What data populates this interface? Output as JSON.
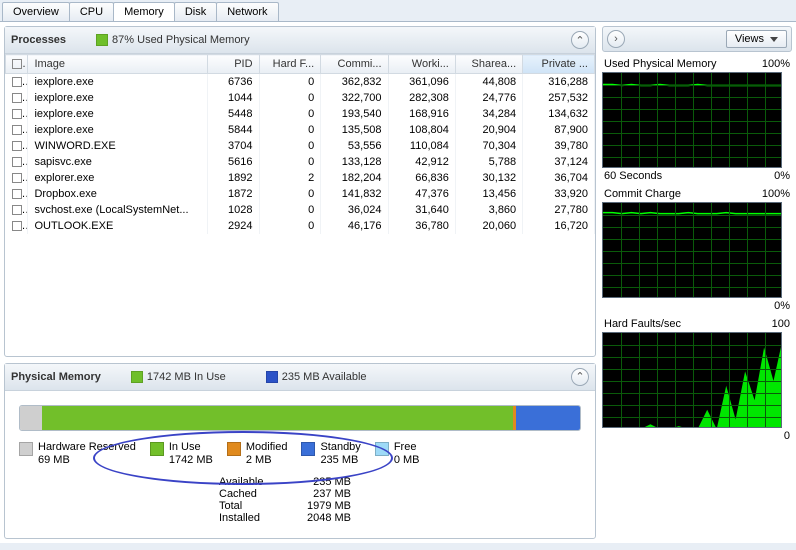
{
  "tabs": [
    "Overview",
    "CPU",
    "Memory",
    "Disk",
    "Network"
  ],
  "active_tab": 2,
  "processes": {
    "title": "Processes",
    "usage_pct": "87% Used Physical Memory",
    "usage_color": "#6fbf2a",
    "columns": [
      "Image",
      "PID",
      "Hard F...",
      "Commi...",
      "Worki...",
      "Sharea...",
      "Private ..."
    ],
    "sorted_col": 6,
    "rows": [
      {
        "image": "iexplore.exe",
        "pid": 6736,
        "hard": 0,
        "commit": "362,832",
        "working": "361,096",
        "share": "44,808",
        "private": "316,288"
      },
      {
        "image": "iexplore.exe",
        "pid": 1044,
        "hard": 0,
        "commit": "322,700",
        "working": "282,308",
        "share": "24,776",
        "private": "257,532"
      },
      {
        "image": "iexplore.exe",
        "pid": 5448,
        "hard": 0,
        "commit": "193,540",
        "working": "168,916",
        "share": "34,284",
        "private": "134,632"
      },
      {
        "image": "iexplore.exe",
        "pid": 5844,
        "hard": 0,
        "commit": "135,508",
        "working": "108,804",
        "share": "20,904",
        "private": "87,900"
      },
      {
        "image": "WINWORD.EXE",
        "pid": 3704,
        "hard": 0,
        "commit": "53,556",
        "working": "110,084",
        "share": "70,304",
        "private": "39,780"
      },
      {
        "image": "sapisvc.exe",
        "pid": 5616,
        "hard": 0,
        "commit": "133,128",
        "working": "42,912",
        "share": "5,788",
        "private": "37,124"
      },
      {
        "image": "explorer.exe",
        "pid": 1892,
        "hard": 2,
        "commit": "182,204",
        "working": "66,836",
        "share": "30,132",
        "private": "36,704"
      },
      {
        "image": "Dropbox.exe",
        "pid": 1872,
        "hard": 0,
        "commit": "141,832",
        "working": "47,376",
        "share": "13,456",
        "private": "33,920"
      },
      {
        "image": "svchost.exe (LocalSystemNet...",
        "pid": 1028,
        "hard": 0,
        "commit": "36,024",
        "working": "31,640",
        "share": "3,860",
        "private": "27,780"
      },
      {
        "image": "OUTLOOK.EXE",
        "pid": 2924,
        "hard": 0,
        "commit": "46,176",
        "working": "36,780",
        "share": "20,060",
        "private": "16,720"
      }
    ]
  },
  "phys": {
    "title": "Physical Memory",
    "in_use_mb": "1742 MB In Use",
    "in_use_color": "#6fbf2a",
    "available_mb": "235 MB Available",
    "available_color": "#2b52c7",
    "segments": [
      {
        "label": "Hardware Reserved",
        "value": "69 MB",
        "color": "#cfcfcf",
        "width": "4%"
      },
      {
        "label": "In Use",
        "value": "1742 MB",
        "color": "#72bf2a",
        "width": "84%"
      },
      {
        "label": "Modified",
        "value": "2 MB",
        "color": "#e08a1e",
        "width": "0.5%"
      },
      {
        "label": "Standby",
        "value": "235 MB",
        "color": "#3a6fd8",
        "width": "11.5%"
      },
      {
        "label": "Free",
        "value": "0 MB",
        "color": "#9edaf7",
        "width": "0%"
      }
    ],
    "summary": [
      {
        "lbl": "Available",
        "val": "235 MB"
      },
      {
        "lbl": "Cached",
        "val": "237 MB"
      },
      {
        "lbl": "Total",
        "val": "1979 MB"
      },
      {
        "lbl": "Installed",
        "val": "2048 MB"
      }
    ]
  },
  "right": {
    "views_label": "Views",
    "graphs": [
      {
        "title": "Used Physical Memory",
        "max": "100%",
        "bottom_left": "60 Seconds",
        "bottom_right": "0%",
        "type": "flat-high"
      },
      {
        "title": "Commit Charge",
        "max": "100%",
        "bottom_left": "",
        "bottom_right": "0%",
        "type": "flat-high"
      },
      {
        "title": "Hard Faults/sec",
        "max": "100",
        "bottom_left": "",
        "bottom_right": "0",
        "type": "spiky"
      }
    ]
  },
  "chart_data": [
    {
      "type": "line",
      "title": "Used Physical Memory",
      "ylabel": "%",
      "ylim": [
        0,
        100
      ],
      "x_span_seconds": 60,
      "values": [
        88,
        88,
        87,
        88,
        87,
        87,
        88,
        87,
        87,
        87,
        88,
        87,
        87,
        87,
        87,
        87,
        87,
        87,
        87,
        87
      ]
    },
    {
      "type": "line",
      "title": "Commit Charge",
      "ylabel": "%",
      "ylim": [
        0,
        100
      ],
      "x_span_seconds": 60,
      "values": [
        90,
        90,
        89,
        90,
        89,
        90,
        89,
        89,
        89,
        90,
        89,
        89,
        89,
        90,
        89,
        89,
        89,
        89,
        89,
        89
      ]
    },
    {
      "type": "area",
      "title": "Hard Faults/sec",
      "ylabel": "faults/s",
      "ylim": [
        0,
        100
      ],
      "x_span_seconds": 60,
      "values": [
        0,
        0,
        0,
        0,
        0,
        5,
        0,
        0,
        3,
        0,
        0,
        20,
        0,
        45,
        10,
        60,
        30,
        85,
        50,
        95
      ]
    }
  ]
}
